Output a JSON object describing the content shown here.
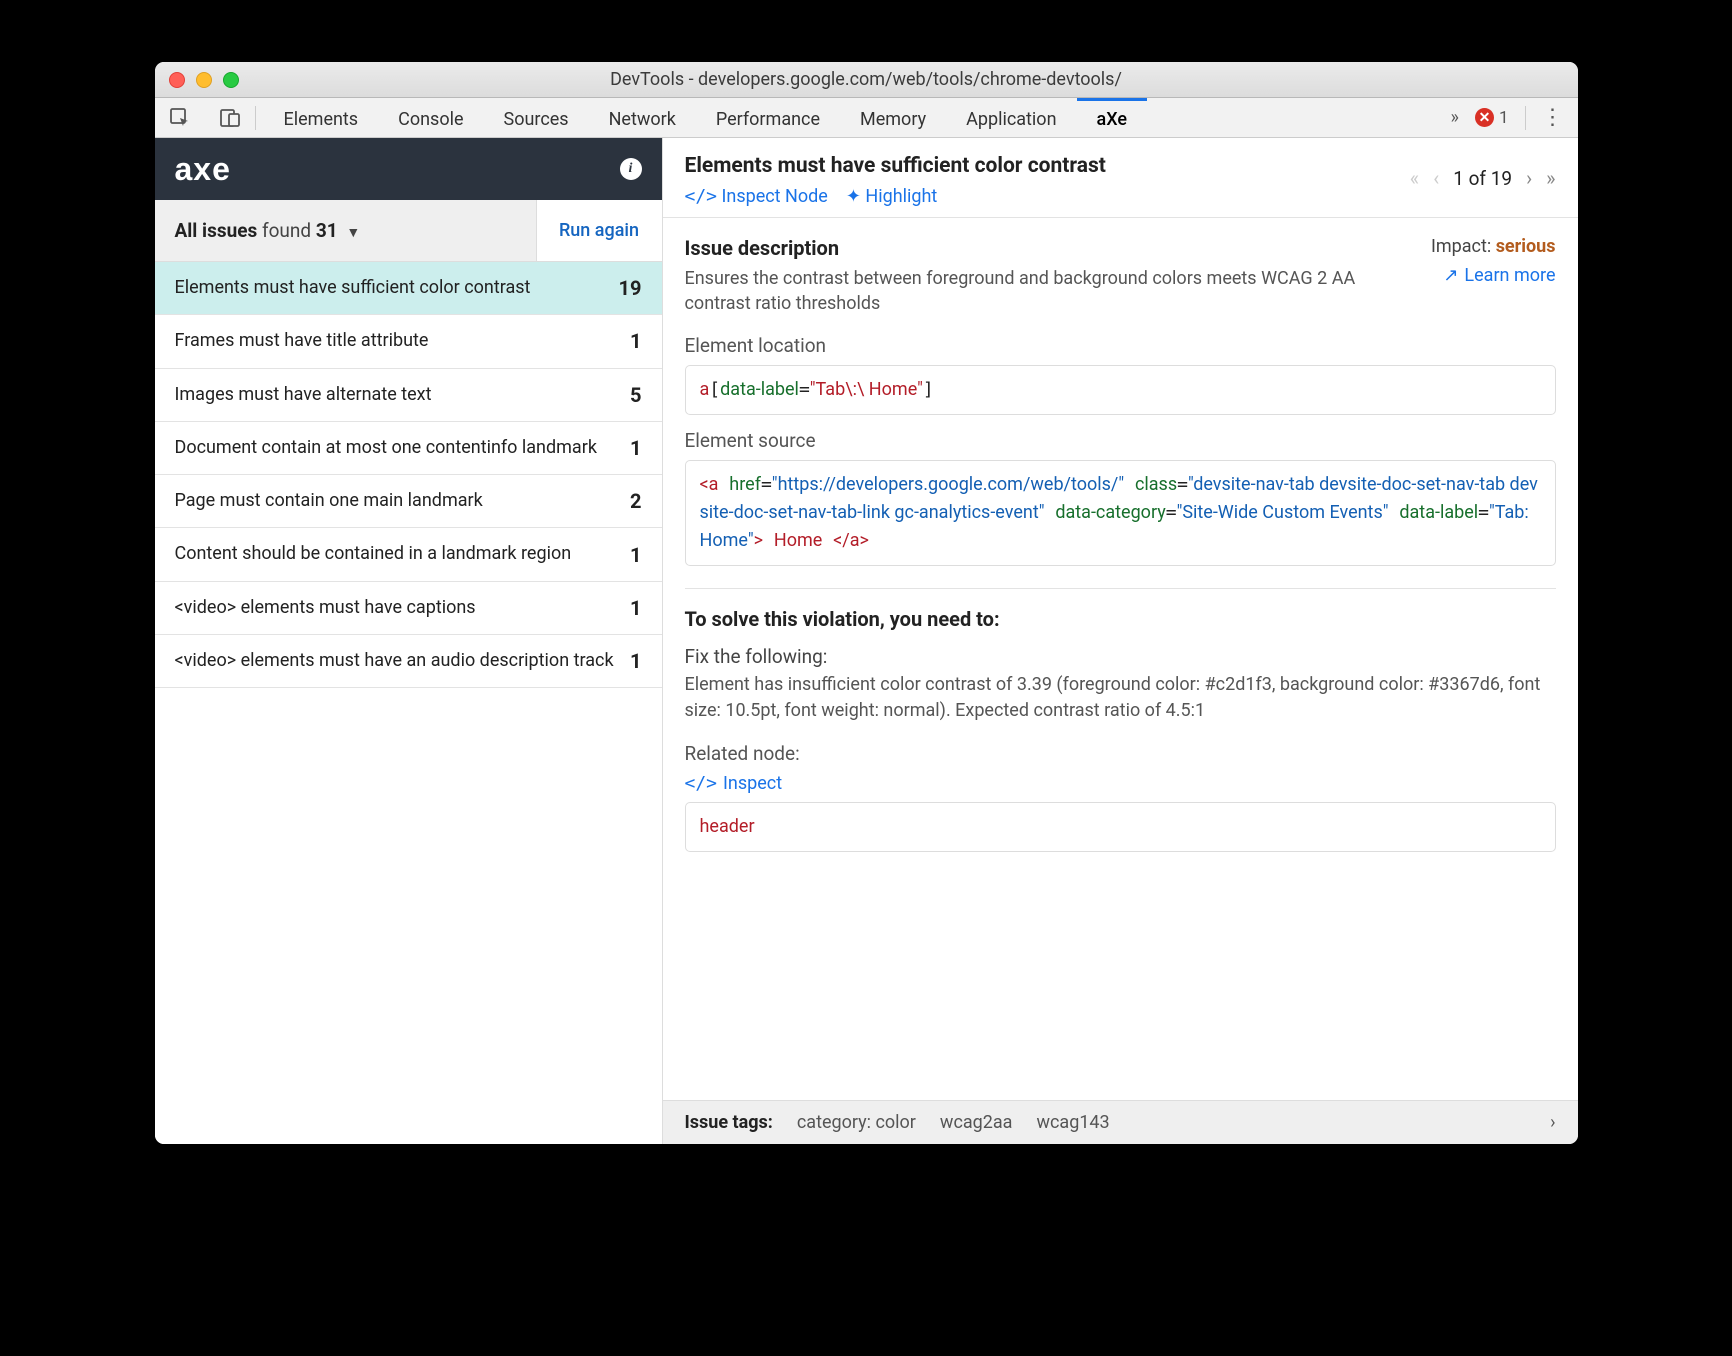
{
  "window_title": "DevTools - developers.google.com/web/tools/chrome-devtools/",
  "devtools_tabs": [
    "Elements",
    "Console",
    "Sources",
    "Network",
    "Performance",
    "Memory",
    "Application",
    "aXe"
  ],
  "active_tab": "aXe",
  "error_count": "1",
  "brand": "axe",
  "all_issues": {
    "label": "All issues",
    "found_label": "found",
    "count": "31"
  },
  "run_again": "Run again",
  "issues": [
    {
      "text": "Elements must have sufficient color contrast",
      "count": "19",
      "selected": true
    },
    {
      "text": "Frames must have title attribute",
      "count": "1"
    },
    {
      "text": "Images must have alternate text",
      "count": "5"
    },
    {
      "text": "Document contain at most one contentinfo landmark",
      "count": "1"
    },
    {
      "text": "Page must contain one main landmark",
      "count": "2"
    },
    {
      "text": "Content should be contained in a landmark region",
      "count": "1"
    },
    {
      "text": "<video> elements must have captions",
      "count": "1"
    },
    {
      "text": "<video> elements must have an audio description track",
      "count": "1"
    }
  ],
  "detail": {
    "title": "Elements must have sufficient color contrast",
    "inspect_node": "Inspect Node",
    "highlight": "Highlight",
    "pager": {
      "index": "1",
      "total": "19",
      "text": "1 of 19"
    },
    "issue_desc_heading": "Issue description",
    "issue_desc": "Ensures the contrast between foreground and background colors meets WCAG 2 AA contrast ratio thresholds",
    "impact_label": "Impact:",
    "impact_value": "serious",
    "learn_more": "Learn more",
    "element_location_label": "Element location",
    "element_location": "a[data-label=\"Tab\\:\\ Home\"]",
    "element_source_label": "Element source",
    "source": {
      "href": "https://developers.google.com/web/tools/",
      "class": "devsite-nav-tab devsite-doc-set-nav-tab devsite-doc-set-nav-tab-link gc-analytics-event",
      "data_category": "Site-Wide Custom Events",
      "data_label": "Tab: Home",
      "text": "Home"
    },
    "solve_heading": "To solve this violation, you need to:",
    "fix_label": "Fix the following:",
    "fix_text": "Element has insufficient color contrast of 3.39 (foreground color: #c2d1f3, background color: #3367d6, font size: 10.5pt, font weight: normal). Expected contrast ratio of 4.5:1",
    "related_node_label": "Related node:",
    "inspect": "Inspect",
    "related_node_code": "header"
  },
  "tagbar": {
    "label": "Issue tags:",
    "tags": [
      "category: color",
      "wcag2aa",
      "wcag143"
    ]
  }
}
